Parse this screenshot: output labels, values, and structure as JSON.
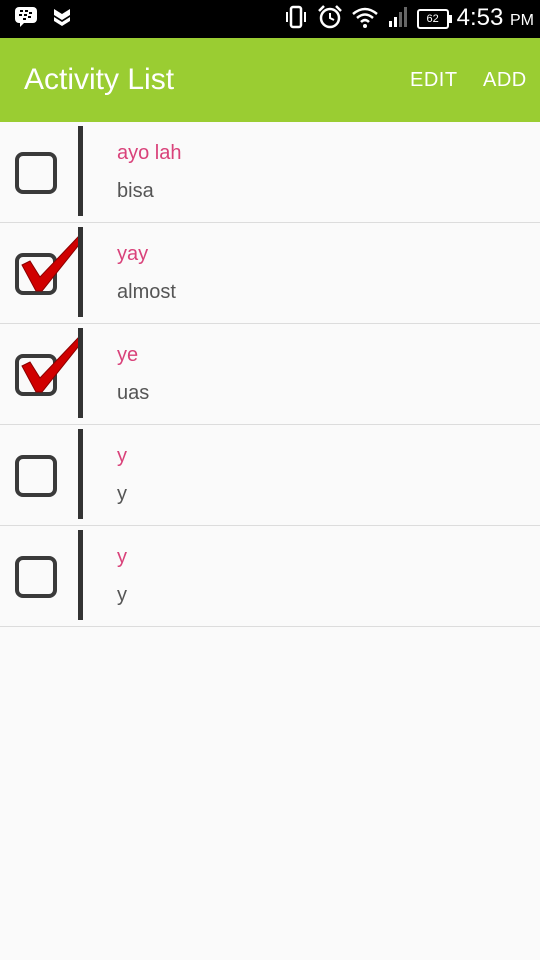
{
  "status_bar": {
    "time": "4:53",
    "ampm": "PM",
    "battery": "62"
  },
  "app_bar": {
    "title": "Activity List",
    "edit_label": "EDIT",
    "add_label": "ADD"
  },
  "activities": [
    {
      "title": "ayo lah",
      "subtitle": "bisa",
      "checked": false
    },
    {
      "title": "yay",
      "subtitle": "almost",
      "checked": true
    },
    {
      "title": "ye",
      "subtitle": "uas",
      "checked": true
    },
    {
      "title": "y",
      "subtitle": "y",
      "checked": false
    },
    {
      "title": "y",
      "subtitle": "y",
      "checked": false
    }
  ],
  "colors": {
    "app_bar": "#9acd32",
    "title_text": "#d9427a",
    "check_mark": "#d00000"
  }
}
